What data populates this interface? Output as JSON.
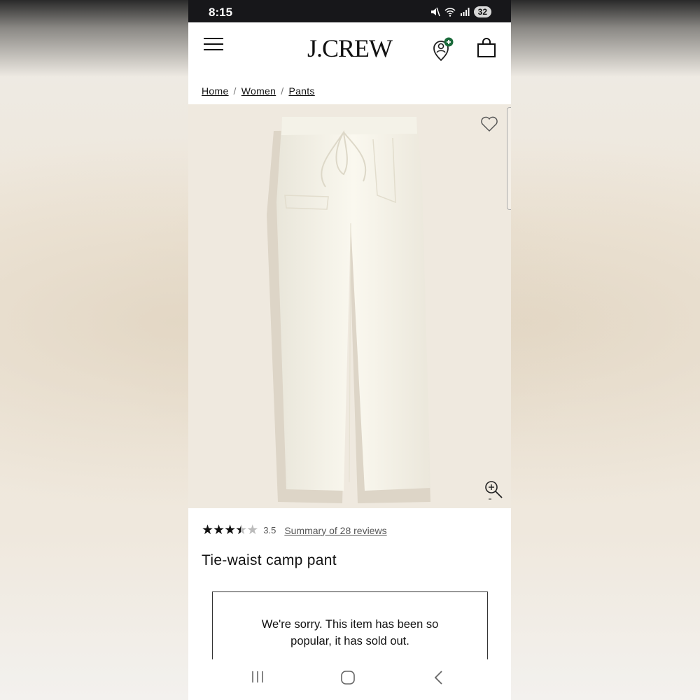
{
  "status_bar": {
    "time": "8:15",
    "battery": "32"
  },
  "header": {
    "logo": "J.CREW"
  },
  "breadcrumb": {
    "items": [
      "Home",
      "Women",
      "Pants"
    ],
    "separator": "/"
  },
  "product": {
    "rating_value": "3.5",
    "rating_stars": 3.5,
    "reviews_link": "Summary of 28 reviews",
    "name": "Tie-waist camp pant",
    "soldout_message": "We're sorry. This item has been so popular, it has sold out."
  },
  "colors": {
    "accent_badge": "#1a6a3a",
    "image_bg": "#efe9df"
  },
  "icons": [
    "menu-icon",
    "account-icon",
    "bag-icon",
    "heart-icon",
    "zoom-in-icon",
    "recents-icon",
    "home-icon",
    "back-icon"
  ]
}
